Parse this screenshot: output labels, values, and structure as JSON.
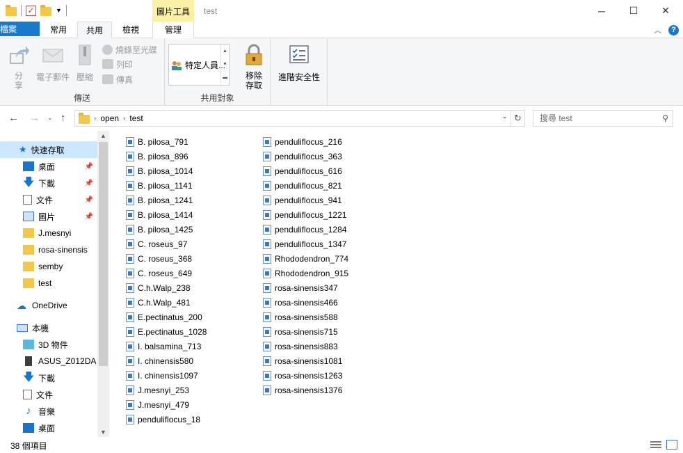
{
  "window": {
    "title": "test",
    "context_tab_title": "圖片工具"
  },
  "ribbon_tabs": {
    "file": "檔案",
    "home": "常用",
    "share": "共用",
    "view": "檢視",
    "manage": "管理"
  },
  "ribbon": {
    "send_group": {
      "label": "傳送",
      "share": "分享",
      "email": "電子郵件",
      "zip": "壓縮",
      "burn": "燒錄至光碟",
      "print": "列印",
      "fax": "傳真"
    },
    "share_with_group": {
      "label": "共用對象",
      "specific_people": "特定人員...",
      "remove_access": "移除存取"
    },
    "advanced_security": "進階安全性"
  },
  "address": {
    "crumbs": [
      "open",
      "test"
    ],
    "search_placeholder": "搜尋 test"
  },
  "nav": {
    "quick_access": "快速存取",
    "items": [
      {
        "label": "桌面",
        "icon": "desktop-icon",
        "pinned": true
      },
      {
        "label": "下載",
        "icon": "download-icon",
        "pinned": true
      },
      {
        "label": "文件",
        "icon": "document-icon",
        "pinned": true
      },
      {
        "label": "圖片",
        "icon": "pictures-icon",
        "pinned": true
      },
      {
        "label": "J.mesnyi",
        "icon": "folder-icon",
        "pinned": false
      },
      {
        "label": "rosa-sinensis",
        "icon": "folder-icon",
        "pinned": false
      },
      {
        "label": "semby",
        "icon": "folder-icon",
        "pinned": false
      },
      {
        "label": "test",
        "icon": "folder-icon",
        "pinned": false
      }
    ],
    "onedrive": "OneDrive",
    "this_pc": "本機",
    "pc_items": [
      {
        "label": "3D 物件",
        "icon": "3d-objects-icon"
      },
      {
        "label": "ASUS_Z012DA",
        "icon": "phone-icon"
      },
      {
        "label": "下載",
        "icon": "download-icon"
      },
      {
        "label": "文件",
        "icon": "document-icon"
      },
      {
        "label": "音樂",
        "icon": "music-icon"
      },
      {
        "label": "桌面",
        "icon": "desktop-icon"
      }
    ]
  },
  "files_col1": [
    "B. pilosa_791",
    "B. pilosa_896",
    "B. pilosa_1014",
    "B. pilosa_1141",
    "B. pilosa_1241",
    "B. pilosa_1414",
    "B. pilosa_1425",
    "C. roseus_97",
    "C. roseus_368",
    "C. roseus_649",
    "C.h.Walp_238",
    "C.h.Walp_481",
    "E.pectinatus_200",
    "E.pectinatus_1028",
    "I. balsamina_713",
    "I. chinensis580",
    "I. chinensis1097",
    "J.mesnyi_253",
    "J.mesnyi_479",
    "penduliflocus_18"
  ],
  "files_col2": [
    "penduliflocus_216",
    "penduliflocus_363",
    "penduliflocus_616",
    "penduliflocus_821",
    "penduliflocus_941",
    "penduliflocus_1221",
    "penduliflocus_1284",
    "penduliflocus_1347",
    "Rhododendron_774",
    "Rhododendron_915",
    "rosa-sinensis347",
    "rosa-sinensis466",
    "rosa-sinensis588",
    "rosa-sinensis715",
    "rosa-sinensis883",
    "rosa-sinensis1081",
    "rosa-sinensis1263",
    "rosa-sinensis1376"
  ],
  "status": {
    "item_count": "38 個項目"
  }
}
